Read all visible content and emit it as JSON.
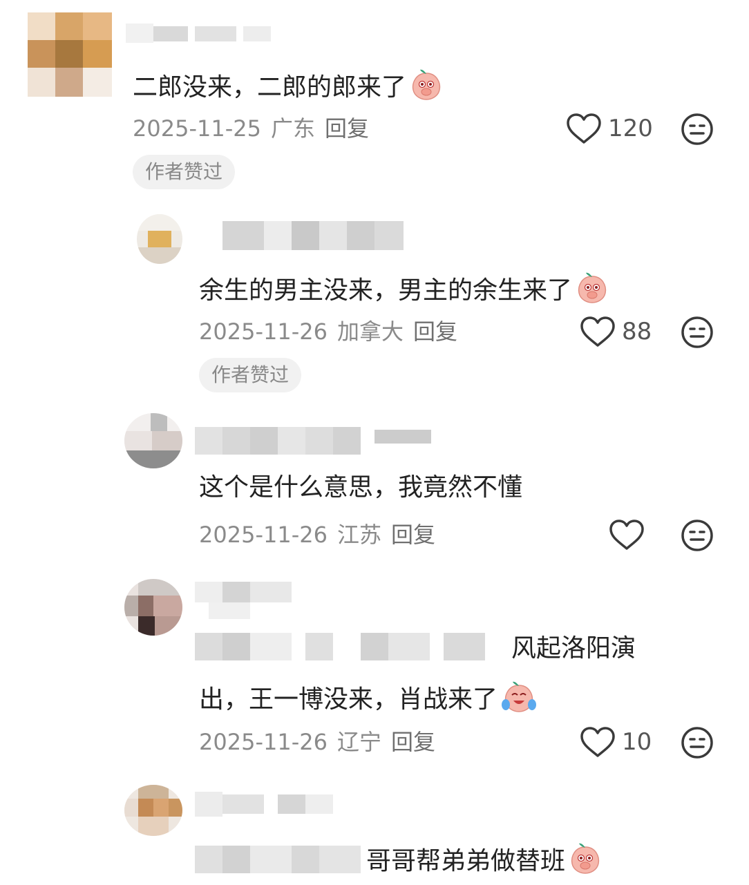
{
  "comments": [
    {
      "text": "二郎没来，二郎的郎来了",
      "date": "2025-11-25",
      "region": "广东",
      "reply": "回复",
      "likes": "120",
      "badge": "作者赞过",
      "emoji": "peach-cover-mouth"
    },
    {
      "text": "余生的男主没来，男主的余生来了",
      "date": "2025-11-26",
      "region": "加拿大",
      "reply": "回复",
      "likes": "88",
      "badge": "作者赞过",
      "emoji": "peach-cover-mouth"
    },
    {
      "text": "这个是什么意思，我竟然不懂",
      "date": "2025-11-26",
      "region": "江苏",
      "reply": "回复",
      "likes": ""
    },
    {
      "text_line1_tail": "风起洛阳演",
      "text_line2": "出，王一博没来，肖战来了",
      "date": "2025-11-26",
      "region": "辽宁",
      "reply": "回复",
      "likes": "10",
      "emoji": "peach-laugh-cry"
    },
    {
      "text_tail": "哥哥帮弟弟做替班",
      "emoji": "peach-cover-mouth"
    }
  ],
  "colors": {
    "peach": "#f6b8ad",
    "leaf": "#3aa37a",
    "meta_text": "#8a8a8a",
    "badge_bg": "#f1f1f1"
  }
}
